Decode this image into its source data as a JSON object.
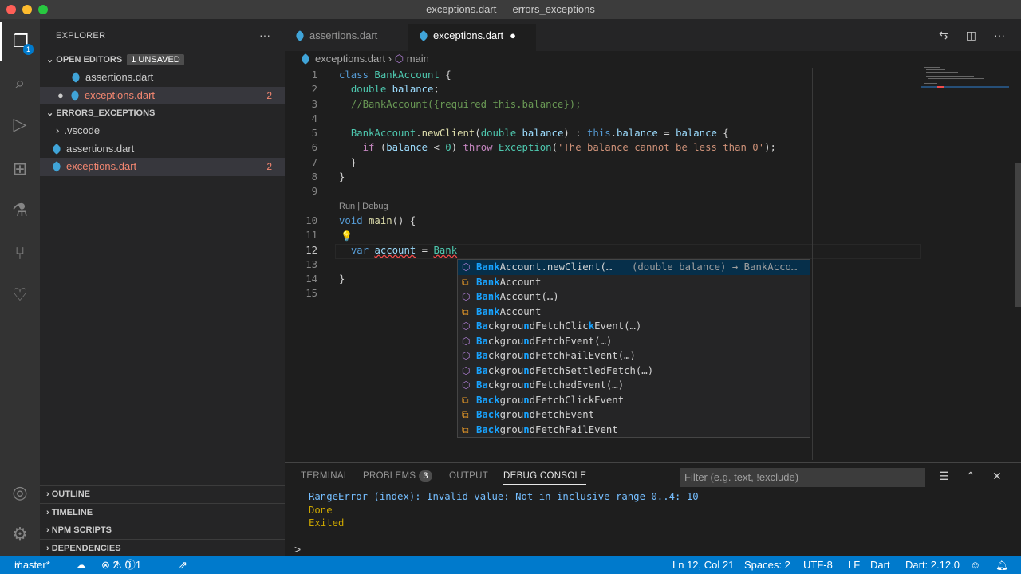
{
  "window": {
    "title": "exceptions.dart — errors_exceptions"
  },
  "activity": {
    "explorer_badge": "1"
  },
  "sidebar": {
    "title": "EXPLORER",
    "open_editors": {
      "label": "OPEN EDITORS",
      "badge": "1 UNSAVED",
      "items": [
        {
          "name": "assertions.dart"
        },
        {
          "name": "exceptions.dart",
          "problems": "2"
        }
      ]
    },
    "folder": {
      "label": "ERRORS_EXCEPTIONS",
      "items": [
        {
          "name": ".vscode"
        },
        {
          "name": "assertions.dart"
        },
        {
          "name": "exceptions.dart",
          "problems": "2"
        }
      ]
    },
    "sections": [
      "OUTLINE",
      "TIMELINE",
      "NPM SCRIPTS",
      "DEPENDENCIES"
    ]
  },
  "tabs": [
    {
      "label": "assertions.dart"
    },
    {
      "label": "exceptions.dart"
    }
  ],
  "breadcrumb": {
    "file": "exceptions.dart",
    "symbol": "main"
  },
  "codelens": "Run | Debug",
  "code": [
    {
      "n": "1",
      "t": [
        [
          "kw",
          "class "
        ],
        [
          "ty",
          "BankAccount"
        ],
        [
          "pl",
          " {"
        ]
      ]
    },
    {
      "n": "2",
      "t": [
        [
          "pl",
          "  "
        ],
        [
          "ty",
          "double"
        ],
        [
          "vr",
          " balance"
        ],
        [
          "pl",
          ";"
        ]
      ]
    },
    {
      "n": "3",
      "t": [
        [
          "cm",
          "  //BankAccount({required this.balance});"
        ]
      ]
    },
    {
      "n": "4",
      "t": []
    },
    {
      "n": "5",
      "t": [
        [
          "pl",
          "  "
        ],
        [
          "ty",
          "BankAccount"
        ],
        [
          "pl",
          "."
        ],
        [
          "fn",
          "newClient"
        ],
        [
          "pl",
          "("
        ],
        [
          "ty",
          "double"
        ],
        [
          "vr",
          " balance"
        ],
        [
          "pl",
          ") : "
        ],
        [
          "kw",
          "this"
        ],
        [
          "pl",
          "."
        ],
        [
          "vr",
          "balance"
        ],
        [
          "pl",
          " = "
        ],
        [
          "vr",
          "balance"
        ],
        [
          "pl",
          " {"
        ]
      ]
    },
    {
      "n": "6",
      "t": [
        [
          "pl",
          "    "
        ],
        [
          "ct",
          "if"
        ],
        [
          "pl",
          " ("
        ],
        [
          "vr",
          "balance"
        ],
        [
          "pl",
          " < "
        ],
        [
          "ty",
          "0"
        ],
        [
          "pl",
          ") "
        ],
        [
          "ct",
          "throw "
        ],
        [
          "ty",
          "Exception"
        ],
        [
          "pl",
          "("
        ],
        [
          "st",
          "'The balance cannot be less than 0'"
        ],
        [
          "pl",
          ");"
        ]
      ]
    },
    {
      "n": "7",
      "t": [
        [
          "pl",
          "  }"
        ]
      ]
    },
    {
      "n": "8",
      "t": [
        [
          "pl",
          "}"
        ]
      ]
    },
    {
      "n": "9",
      "t": []
    },
    {
      "n": "10",
      "t": [
        [
          "kw",
          "void "
        ],
        [
          "fn",
          "main"
        ],
        [
          "pl",
          "() {"
        ]
      ],
      "lens": true
    },
    {
      "n": "11",
      "t": []
    },
    {
      "n": "12",
      "t": [
        [
          "pl",
          "  "
        ],
        [
          "kw",
          "var "
        ],
        [
          "vr sq",
          "account"
        ],
        [
          "pl",
          " = "
        ],
        [
          "ty sq",
          "Bank"
        ]
      ],
      "cur": true
    },
    {
      "n": "13",
      "t": []
    },
    {
      "n": "14",
      "t": [
        [
          "pl",
          "}"
        ]
      ]
    },
    {
      "n": "15",
      "t": []
    }
  ],
  "suggestions": [
    {
      "kind": "constructor",
      "parts": [
        [
          "m",
          "Bank"
        ],
        [
          "",
          "Account.newClient(…"
        ]
      ],
      "detail": "(double balance) → BankAcco…",
      "focus": true
    },
    {
      "kind": "class",
      "parts": [
        [
          "m",
          "Bank"
        ],
        [
          "",
          "Account"
        ]
      ]
    },
    {
      "kind": "constructor",
      "parts": [
        [
          "m",
          "Bank"
        ],
        [
          "",
          "Account(…)"
        ]
      ]
    },
    {
      "kind": "class",
      "parts": [
        [
          "m",
          "Bank"
        ],
        [
          "",
          "Account"
        ]
      ]
    },
    {
      "kind": "constructor",
      "parts": [
        [
          "m",
          "Ba"
        ],
        [
          "",
          "ckgrou"
        ],
        [
          "m",
          "n"
        ],
        [
          "",
          "dFetchClic"
        ],
        [
          "m",
          "k"
        ],
        [
          "",
          "Event(…)"
        ]
      ]
    },
    {
      "kind": "constructor",
      "parts": [
        [
          "m",
          "Ba"
        ],
        [
          "",
          "ckgrou"
        ],
        [
          "m",
          "n"
        ],
        [
          "",
          "dFetchEvent(…)"
        ]
      ]
    },
    {
      "kind": "constructor",
      "parts": [
        [
          "m",
          "Ba"
        ],
        [
          "",
          "ckgrou"
        ],
        [
          "m",
          "n"
        ],
        [
          "",
          "dFetchFailEvent(…)"
        ]
      ]
    },
    {
      "kind": "constructor",
      "parts": [
        [
          "m",
          "Ba"
        ],
        [
          "",
          "ckgrou"
        ],
        [
          "m",
          "n"
        ],
        [
          "",
          "dFetchSettledFetch(…)"
        ]
      ]
    },
    {
      "kind": "constructor",
      "parts": [
        [
          "m",
          "Ba"
        ],
        [
          "",
          "ckgrou"
        ],
        [
          "m",
          "n"
        ],
        [
          "",
          "dFetchedEvent(…)"
        ]
      ]
    },
    {
      "kind": "class",
      "parts": [
        [
          "m",
          "Back"
        ],
        [
          "",
          "grou"
        ],
        [
          "m",
          "n"
        ],
        [
          "",
          "dFetchClickEvent"
        ]
      ]
    },
    {
      "kind": "class",
      "parts": [
        [
          "m",
          "Back"
        ],
        [
          "",
          "grou"
        ],
        [
          "m",
          "n"
        ],
        [
          "",
          "dFetchEvent"
        ]
      ]
    },
    {
      "kind": "class",
      "parts": [
        [
          "m",
          "Back"
        ],
        [
          "",
          "grou"
        ],
        [
          "m",
          "n"
        ],
        [
          "",
          "dFetchFailEvent"
        ]
      ]
    }
  ],
  "panel": {
    "tabs": {
      "terminal": "TERMINAL",
      "problems": "PROBLEMS",
      "problems_count": "3",
      "output": "OUTPUT",
      "debug": "DEBUG CONSOLE"
    },
    "filter_placeholder": "Filter (e.g. text, !exclude)",
    "console": [
      "RangeError (index): Invalid value: Not in inclusive range 0..4: 10",
      "Done",
      "Exited"
    ],
    "prompt": ">"
  },
  "status": {
    "branch": "master*",
    "errors": "2",
    "warnings": "0",
    "infos": "1",
    "position": "Ln 12, Col 21",
    "spaces": "Spaces: 2",
    "encoding": "UTF-8",
    "eol": "LF",
    "language": "Dart",
    "sdk": "Dart: 2.12.0"
  },
  "colors": {
    "accent": "#007acc",
    "error": "#f48771",
    "match": "#18a3ff"
  }
}
